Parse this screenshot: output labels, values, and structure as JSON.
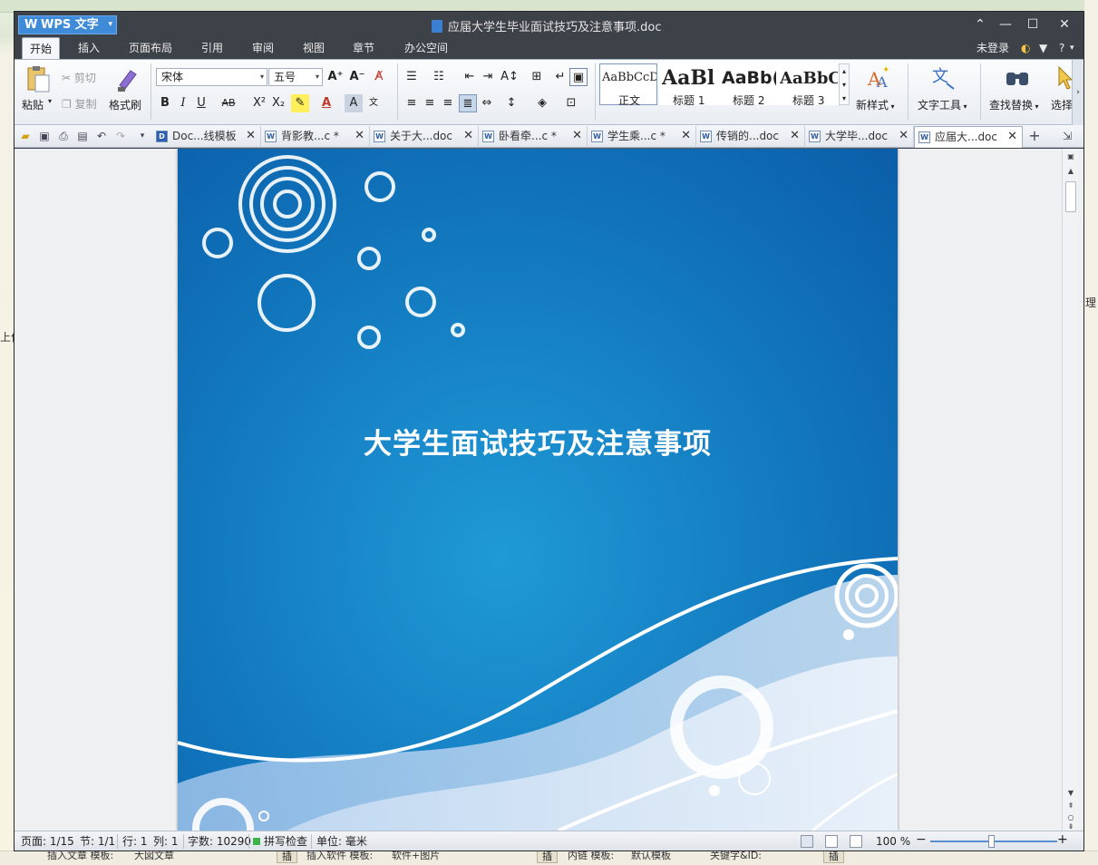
{
  "window": {
    "app_name": "WPS 文字",
    "doc_title": "应届大学生毕业面试技巧及注意事项.doc",
    "controls": {
      "minimize": "—",
      "maximize": "☐",
      "close": "✕",
      "collapse": "⌃"
    }
  },
  "menubar": {
    "items": [
      "开始",
      "插入",
      "页面布局",
      "引用",
      "审阅",
      "视图",
      "章节",
      "办公空间"
    ],
    "active": "开始",
    "login": "未登录",
    "help": "?"
  },
  "ribbon": {
    "paste": "粘贴",
    "cut": "剪切",
    "copy": "复制",
    "format_painter": "格式刷",
    "font_name": "宋体",
    "font_size": "五号",
    "styles": [
      {
        "sample": "AaBbCcDd",
        "name": "正文"
      },
      {
        "sample": "AaBl",
        "name": "标题 1"
      },
      {
        "sample": "AaBb(",
        "name": "标题 2"
      },
      {
        "sample": "AaBbC",
        "name": "标题 3"
      }
    ],
    "new_style": "新样式",
    "text_tools": "文字工具",
    "find_replace": "查找替换",
    "select": "选择"
  },
  "tabs": [
    {
      "label": "Doc...线模板",
      "active": false
    },
    {
      "label": "背影教...c *",
      "active": false
    },
    {
      "label": "关于大...doc",
      "active": false
    },
    {
      "label": "卧看牵...c *",
      "active": false
    },
    {
      "label": "学生乘...c *",
      "active": false
    },
    {
      "label": "传销的...doc",
      "active": false
    },
    {
      "label": "大学毕...doc",
      "active": false
    },
    {
      "label": "应届大...doc",
      "active": true
    }
  ],
  "document": {
    "cover_title": "大学生面试技巧及注意事项"
  },
  "statusbar": {
    "page": "页面: 1/15",
    "section": "节: 1/1",
    "row": "行: 1",
    "col": "列: 1",
    "word_count": "字数: 10290",
    "spell_check": "拼写检查",
    "unit": "单位: 毫米",
    "zoom": "100 %",
    "zoom_level": 0.48
  },
  "background": {
    "bottom_fields": [
      "插入文章 模板:",
      "大図文章",
      "插入软件 模板:",
      "软件+图片",
      "内链 模板:",
      "默认模板",
      "关键字&ID:"
    ],
    "bottom_buttons": [
      "插",
      "插",
      "插"
    ],
    "left_text": [
      "理",
      "上作"
    ]
  },
  "colors": {
    "title_bar": "#3d4148",
    "accent": "#3f8bd8",
    "page_blue": "#1784c7"
  }
}
